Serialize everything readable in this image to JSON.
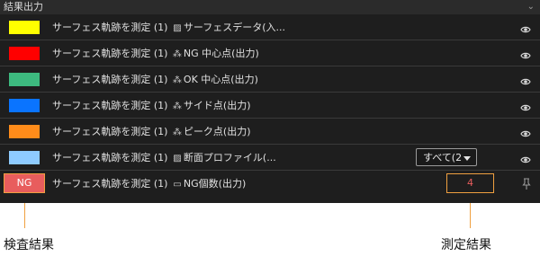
{
  "panel": {
    "title": "結果出力",
    "collapse_icon": "chevron-down-icon"
  },
  "rows": [
    {
      "swatch_color": "#ffff00",
      "source": "サーフェス軌跡を測定 (1)",
      "icon": "hatched-square-icon",
      "label": "サーフェスデータ(入..."
    },
    {
      "swatch_color": "#ff0000",
      "source": "サーフェス軌跡を測定 (1)",
      "icon": "point-cluster-icon",
      "label": "NG 中心点(出力)"
    },
    {
      "swatch_color": "#3dba7f",
      "source": "サーフェス軌跡を測定 (1)",
      "icon": "point-cluster-icon",
      "label": "OK 中心点(出力)"
    },
    {
      "swatch_color": "#0a74ff",
      "source": "サーフェス軌跡を測定 (1)",
      "icon": "point-cluster-icon",
      "label": "サイド点(出力)"
    },
    {
      "swatch_color": "#ff8c1a",
      "source": "サーフェス軌跡を測定 (1)",
      "icon": "point-cluster-icon",
      "label": "ピーク点(出力)"
    },
    {
      "swatch_color": "#8ecbff",
      "source": "サーフェス軌跡を測定 (1)",
      "icon": "hatched-square-icon",
      "label": "断面プロファイル(..."
    }
  ],
  "dropdown": {
    "value": "すべて(2"
  },
  "result_row": {
    "badge": "NG",
    "badge_color": "#e85d5d",
    "source": "サーフェス軌跡を測定 (1)",
    "icon": "counter-icon",
    "label": "NG個数(出力)",
    "value": "4"
  },
  "callouts": {
    "left": "検査結果",
    "right": "測定結果",
    "color": "#f0a040"
  }
}
